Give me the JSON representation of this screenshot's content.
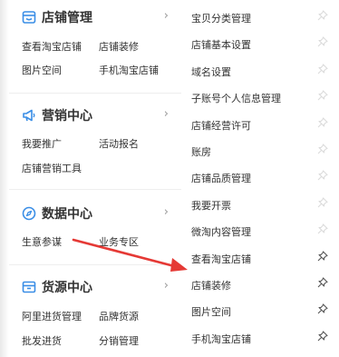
{
  "left_menu": {
    "store": {
      "title": "店铺管理",
      "items": [
        "查看淘宝店铺",
        "店铺装修",
        "图片空间",
        "手机淘宝店铺"
      ]
    },
    "marketing": {
      "title": "营销中心",
      "items": [
        "我要推广",
        "活动报名",
        "店铺营销工具"
      ]
    },
    "data": {
      "title": "数据中心",
      "items": [
        "生意参谋",
        "业务专区"
      ]
    },
    "supply": {
      "title": "货源中心",
      "items": [
        "阿里进货管理",
        "品牌货源",
        "批发进货",
        "分销管理"
      ]
    }
  },
  "right_menu": {
    "items": [
      {
        "label": "宝贝分类管理",
        "pinned": false
      },
      {
        "label": "店铺基本设置",
        "pinned": false
      },
      {
        "label": "域名设置",
        "pinned": false
      },
      {
        "label": "子账号个人信息管理",
        "pinned": false
      },
      {
        "label": "店铺经营许可",
        "pinned": false
      },
      {
        "label": "账房",
        "pinned": false
      },
      {
        "label": "店铺品质管理",
        "pinned": false
      },
      {
        "label": "我要开票",
        "pinned": false
      },
      {
        "label": "微淘内容管理",
        "pinned": false
      },
      {
        "label": "查看淘宝店铺",
        "pinned": true
      },
      {
        "label": "店铺装修",
        "pinned": true
      },
      {
        "label": "图片空间",
        "pinned": true
      },
      {
        "label": "手机淘宝店铺",
        "pinned": true
      }
    ]
  },
  "colors": {
    "icon_blue": "#3a8ee6",
    "arrow_red": "#e53935",
    "text": "#333333",
    "muted": "#999999"
  }
}
